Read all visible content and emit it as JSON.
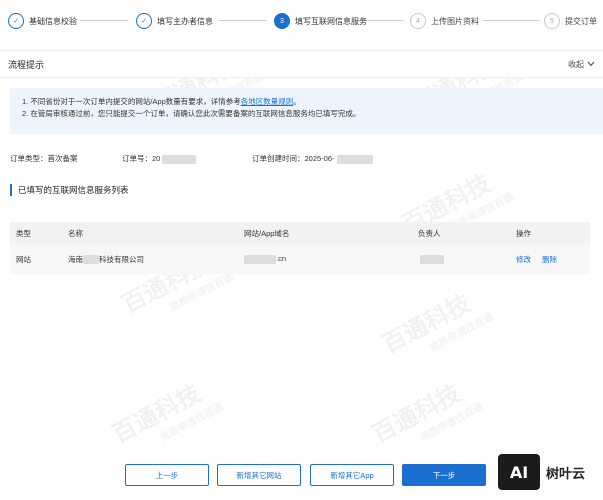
{
  "steps": [
    {
      "label": "基础信息校验",
      "status": "done",
      "number": "✓"
    },
    {
      "label": "填写主办者信息",
      "status": "done",
      "number": "✓"
    },
    {
      "label": "填写互联网信息服务",
      "status": "active",
      "number": "3"
    },
    {
      "label": "上传图片资料",
      "status": "todo",
      "number": "4"
    },
    {
      "label": "提交订单",
      "status": "todo",
      "number": "5"
    }
  ],
  "tips": {
    "title": "流程提示",
    "collapse_label": "收起",
    "line1_prefix": "1. 不同省份对于一次订单内提交的网站/App数量有要求，详情参考",
    "line1_link": "各地区数量规则",
    "line1_suffix": "。",
    "line2": "2. 在管局审核通过前，您只能提交一个订单，请确认您此次需要备案的互联网信息服务均已填写完成。"
  },
  "order": {
    "type_label": "订单类型：首次备案",
    "id_label": "订单号：20",
    "created_label": "订单创建时间：2025-06-"
  },
  "section": {
    "title": "已填写的互联网信息服务列表"
  },
  "table": {
    "headers": [
      "类型",
      "名称",
      "网站/App域名",
      "负责人",
      "操作"
    ],
    "rows": [
      {
        "type": "网站",
        "name_prefix": "海南",
        "name_suffix": "科技有限公司",
        "domain_suffix": ".cn",
        "edit": "修改",
        "delete": "删除"
      }
    ]
  },
  "footer": {
    "prev": "上一步",
    "add_site": "新增其它网站",
    "add_app": "新增其它App",
    "next": "下一步"
  },
  "watermark": {
    "text": "百通科技",
    "sub": "资质申请找百通"
  },
  "corner": {
    "ai": "AI",
    "name": "树叶云"
  },
  "colors": {
    "accent": "#1a6fd1",
    "notice_bg": "#eef4fd"
  }
}
